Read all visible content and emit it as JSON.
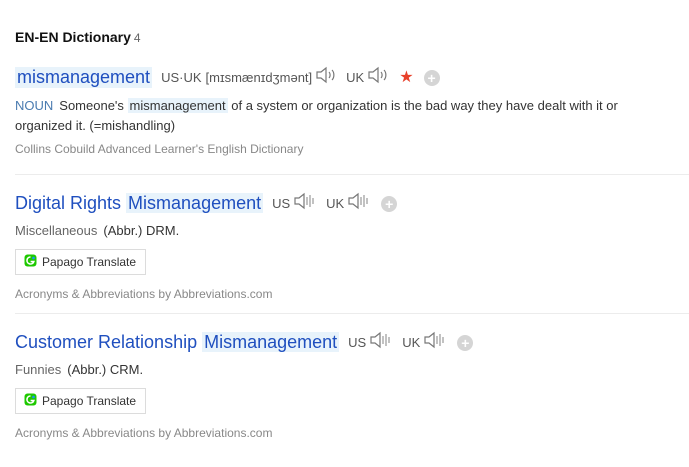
{
  "section": {
    "title": "EN-EN Dictionary",
    "count": "4"
  },
  "entry1": {
    "word": "mismanagement",
    "region_us_uk": "US·UK",
    "phonetic": "[mɪsmænɪdʒmənt]",
    "region_uk": "UK",
    "pos": "NOUN",
    "definition_pre": "Someone's ",
    "definition_hl": "mismanagement",
    "definition_post": " of a system or organization is the bad way they have dealt with it or organized it. (=mishandling)",
    "source": "Collins Cobuild Advanced Learner's English Dictionary"
  },
  "entry2": {
    "word_plain": "Digital Rights ",
    "word_hl": "Mismanagement",
    "region_us": "US",
    "region_uk": "UK",
    "category": "Miscellaneous",
    "abbr": "(Abbr.) DRM.",
    "papago_label": "Papago Translate",
    "source": "Acronyms & Abbreviations by Abbreviations.com"
  },
  "entry3": {
    "word_plain": "Customer Relationship ",
    "word_hl": "Mismanagement",
    "region_us": "US",
    "region_uk": "UK",
    "category": "Funnies",
    "abbr": "(Abbr.) CRM.",
    "papago_label": "Papago Translate",
    "source": "Acronyms & Abbreviations by Abbreviations.com"
  },
  "icons": {
    "speaker": "speaker-icon",
    "star": "star-icon",
    "add": "add-circle-icon",
    "papago": "papago-logo-icon"
  },
  "colors": {
    "link": "#1f4fbf",
    "highlight": "#e8f3fb",
    "star": "#e8402a",
    "pos": "#4a7bb0"
  }
}
